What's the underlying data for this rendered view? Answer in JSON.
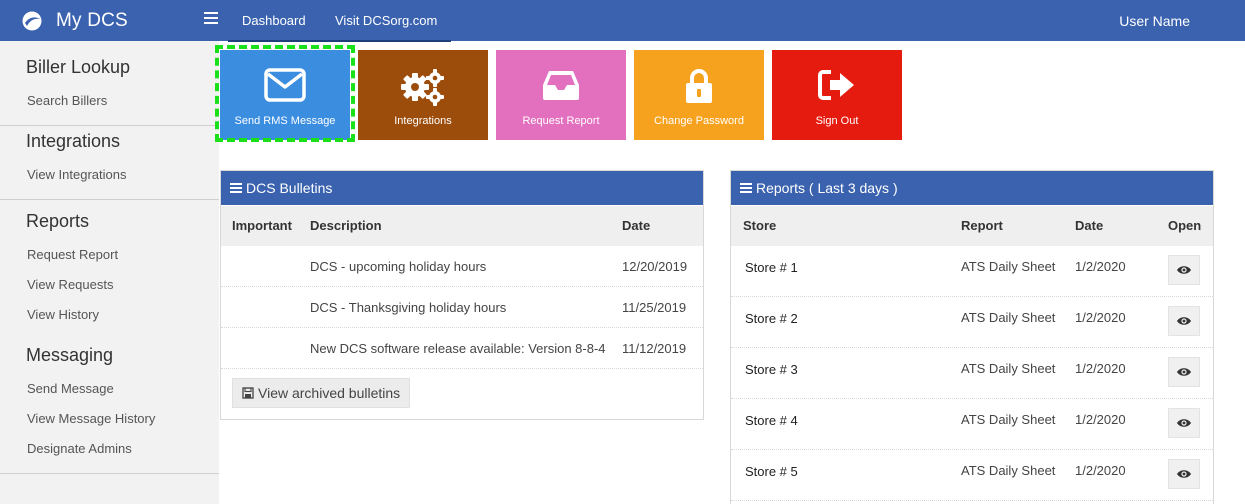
{
  "app": {
    "name": "My DCS",
    "user": "User Name"
  },
  "nav": {
    "links": [
      "Dashboard",
      "Visit DCSorg.com"
    ]
  },
  "sidebar": {
    "sections": [
      {
        "heading": "Biller Lookup",
        "items": [
          "Search Billers"
        ]
      },
      {
        "heading": "Integrations",
        "items": [
          "View Integrations"
        ]
      },
      {
        "heading": "Reports",
        "items": [
          "Request Report",
          "View Requests",
          "View History"
        ]
      },
      {
        "heading": "Messaging",
        "items": [
          "Send Message",
          "View Message History",
          "Designate Admins"
        ]
      }
    ]
  },
  "tiles": [
    {
      "label": "Send RMS Message",
      "color": "#3b8de0",
      "icon": "envelope-icon"
    },
    {
      "label": "Integrations",
      "color": "#9c4d0b",
      "icon": "gears-icon"
    },
    {
      "label": "Request Report",
      "color": "#e36fbf",
      "icon": "inbox-icon"
    },
    {
      "label": "Change Password",
      "color": "#f7a21f",
      "icon": "lock-icon"
    },
    {
      "label": "Sign Out",
      "color": "#e51b0f",
      "icon": "sign-out-icon"
    }
  ],
  "bulletins": {
    "title": "DCS Bulletins",
    "columns": [
      "Important",
      "Description",
      "Date"
    ],
    "rows": [
      {
        "important": "",
        "description": "DCS - upcoming holiday hours",
        "date": "12/20/2019"
      },
      {
        "important": "",
        "description": "DCS - Thanksgiving holiday hours",
        "date": "11/25/2019"
      },
      {
        "important": "",
        "description": "New DCS software release available: Version 8-8-4",
        "date": "11/12/2019"
      }
    ],
    "archive_label": "View archived bulletins"
  },
  "reports": {
    "title": "Reports ( Last 3 days )",
    "columns": [
      "Store",
      "Report",
      "Date",
      "Open"
    ],
    "rows": [
      {
        "store": "Store # 1",
        "report": "ATS Daily Sheet",
        "date": "1/2/2020"
      },
      {
        "store": "Store # 2",
        "report": "ATS Daily Sheet",
        "date": "1/2/2020"
      },
      {
        "store": "Store # 3",
        "report": "ATS Daily Sheet",
        "date": "1/2/2020"
      },
      {
        "store": "Store # 4",
        "report": "ATS Daily Sheet",
        "date": "1/2/2020"
      },
      {
        "store": "Store # 5",
        "report": "ATS Daily Sheet",
        "date": "1/2/2020"
      }
    ]
  }
}
